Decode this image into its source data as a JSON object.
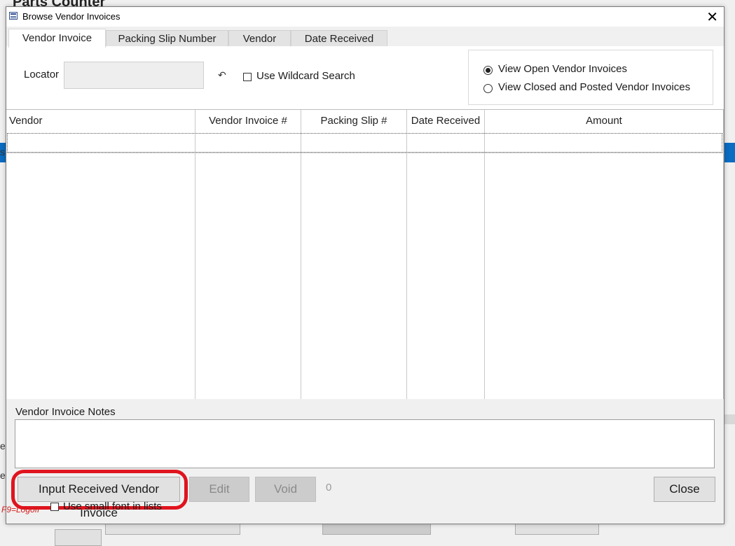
{
  "background": {
    "app_title": "Parts Counter",
    "left_fragments": [
      "s",
      "e",
      "e"
    ]
  },
  "dialog": {
    "title": "Browse Vendor Invoices",
    "close_glyph": "✕"
  },
  "tabs": [
    {
      "label": "Vendor Invoice",
      "active": true
    },
    {
      "label": "Packing Slip Number",
      "active": false
    },
    {
      "label": "Vendor",
      "active": false
    },
    {
      "label": "Date Received",
      "active": false
    }
  ],
  "search": {
    "locator_label": "Locator",
    "locator_value": "",
    "undo_icon": "↶",
    "wildcard_label": "Use Wildcard Search",
    "wildcard_checked": false
  },
  "view_filter": {
    "options": [
      {
        "label": "View Open Vendor Invoices",
        "checked": true
      },
      {
        "label": "View Closed and Posted Vendor Invoices",
        "checked": false
      }
    ]
  },
  "grid": {
    "columns": [
      "Vendor",
      "Vendor Invoice #",
      "Packing Slip #",
      "Date Received",
      "Amount"
    ],
    "rows": []
  },
  "notes": {
    "label": "Vendor Invoice Notes",
    "value": ""
  },
  "buttons": {
    "input_received": "Input Received Vendor Invoice",
    "edit": "Edit",
    "void": "Void",
    "close": "Close"
  },
  "count": "0",
  "footer": {
    "logoff_hint": "F9=Logoff",
    "small_font_label": "Use small font in lists",
    "small_font_checked": false
  },
  "colors": {
    "highlight": "#e0141e",
    "selection_band": "#0a6cc2"
  }
}
